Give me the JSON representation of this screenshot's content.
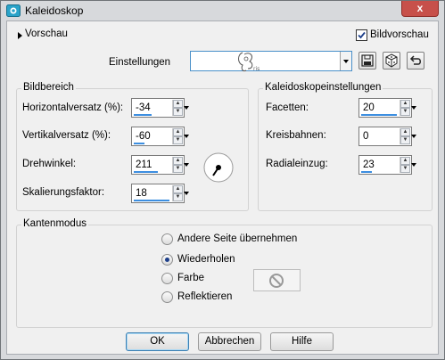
{
  "window": {
    "title": "Kaleidoskop",
    "close_label": "x"
  },
  "top": {
    "preview_toggle": "Vorschau",
    "preview_checkbox": {
      "label": "Bildvorschau",
      "checked": true
    },
    "settings_label": "Einstellungen",
    "settings_value": ""
  },
  "bildbereich": {
    "title": "Bildbereich",
    "fields": [
      {
        "label": "Horizontalversatz (%):",
        "value": "-34"
      },
      {
        "label": "Vertikalversatz (%):",
        "value": "-60"
      },
      {
        "label": "Drehwinkel:",
        "value": "211"
      },
      {
        "label": "Skalierungsfaktor:",
        "value": "18"
      }
    ]
  },
  "kaleido": {
    "title": "Kaleidoskopeinstellungen",
    "fields": [
      {
        "label": "Facetten:",
        "value": "20"
      },
      {
        "label": "Kreisbahnen:",
        "value": "0"
      },
      {
        "label": "Radialeinzug:",
        "value": "23"
      }
    ]
  },
  "kanten": {
    "title": "Kantenmodus",
    "options": [
      {
        "label": "Andere Seite übernehmen",
        "selected": false
      },
      {
        "label": "Wiederholen",
        "selected": true
      },
      {
        "label": "Farbe",
        "selected": false
      },
      {
        "label": "Reflektieren",
        "selected": false
      }
    ]
  },
  "buttons": {
    "ok": "OK",
    "cancel": "Abbrechen",
    "help": "Hilfe"
  },
  "colors": {
    "accent": "#3c8ee0",
    "close": "#c7504a"
  }
}
